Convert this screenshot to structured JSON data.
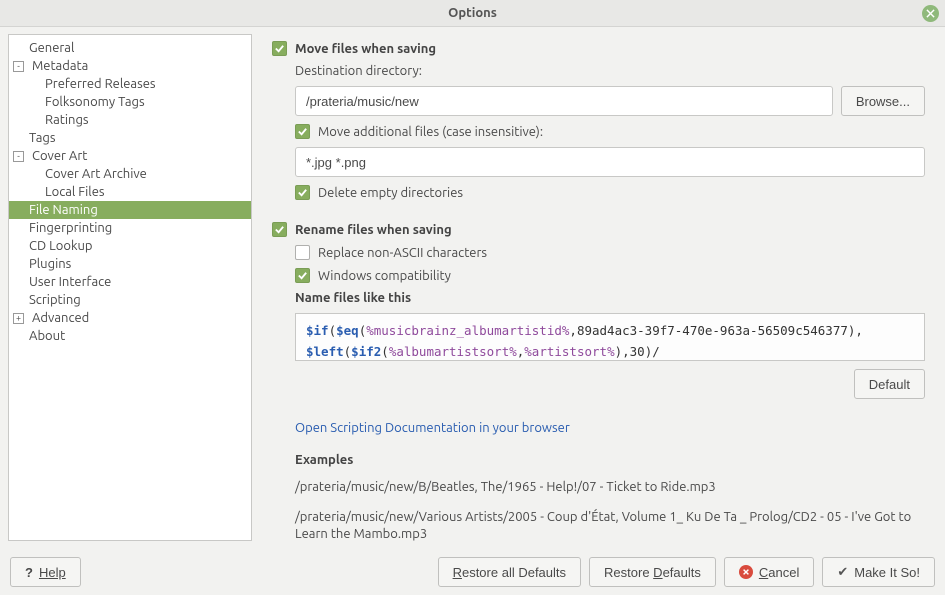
{
  "window": {
    "title": "Options"
  },
  "tree": {
    "items": [
      {
        "label": "General",
        "indent": 1,
        "expander": ""
      },
      {
        "label": "Metadata",
        "indent": 0,
        "expander": "-"
      },
      {
        "label": "Preferred Releases",
        "indent": 2,
        "expander": ""
      },
      {
        "label": "Folksonomy Tags",
        "indent": 2,
        "expander": ""
      },
      {
        "label": "Ratings",
        "indent": 2,
        "expander": ""
      },
      {
        "label": "Tags",
        "indent": 1,
        "expander": ""
      },
      {
        "label": "Cover Art",
        "indent": 0,
        "expander": "-"
      },
      {
        "label": "Cover Art Archive",
        "indent": 2,
        "expander": ""
      },
      {
        "label": "Local Files",
        "indent": 2,
        "expander": ""
      },
      {
        "label": "File Naming",
        "indent": 1,
        "expander": "",
        "selected": true
      },
      {
        "label": "Fingerprinting",
        "indent": 1,
        "expander": ""
      },
      {
        "label": "CD Lookup",
        "indent": 1,
        "expander": ""
      },
      {
        "label": "Plugins",
        "indent": 1,
        "expander": ""
      },
      {
        "label": "User Interface",
        "indent": 1,
        "expander": ""
      },
      {
        "label": "Scripting",
        "indent": 1,
        "expander": ""
      },
      {
        "label": "Advanced",
        "indent": 0,
        "expander": "+"
      },
      {
        "label": "About",
        "indent": 1,
        "expander": ""
      }
    ]
  },
  "content": {
    "move_files_label": "Move files when saving",
    "dest_dir_label": "Destination directory:",
    "dest_dir_value": "/prateria/music/new",
    "browse_label": "Browse...",
    "move_additional_label": "Move additional files (case insensitive):",
    "move_additional_value": "*.jpg *.png",
    "delete_empty_label": "Delete empty directories",
    "rename_label": "Rename files when saving",
    "replace_non_ascii_label": "Replace non-ASCII characters",
    "windows_compat_label": "Windows compatibility",
    "name_files_label": "Name files like this",
    "code_line1_fn1": "$if",
    "code_line1_p1": "(",
    "code_line1_fn2": "$eq",
    "code_line1_p2": "(",
    "code_line1_var1": "%musicbrainz_albumartistid%",
    "code_line1_rest": ",89ad4ac3-39f7-470e-963a-56509c546377)",
    "code_line1_end": ",",
    "code_line2_fn1": "$left",
    "code_line2_p1": "(",
    "code_line2_fn2": "$if2",
    "code_line2_p2": "(",
    "code_line2_var1": "%albumartistsort%",
    "code_line2_c": ",",
    "code_line2_var2": "%artistsort%",
    "code_line2_rest": "),30)/",
    "default_label": "Default",
    "doc_link": "Open Scripting Documentation in your browser",
    "examples_label": "Examples",
    "example1": "/prateria/music/new/B/Beatles, The/1965 - Help!/07 - Ticket to Ride.mp3",
    "example2": "/prateria/music/new/Various Artists/2005 - Coup d'État, Volume 1_ Ku De Ta _ Prolog/CD2 - 05 - I've Got to Learn the Mambo.mp3"
  },
  "footer": {
    "help": "Help",
    "restore_all": "Restore all Defaults",
    "restore": "Restore Defaults",
    "cancel": "Cancel",
    "make_it_so": "Make It So!"
  }
}
